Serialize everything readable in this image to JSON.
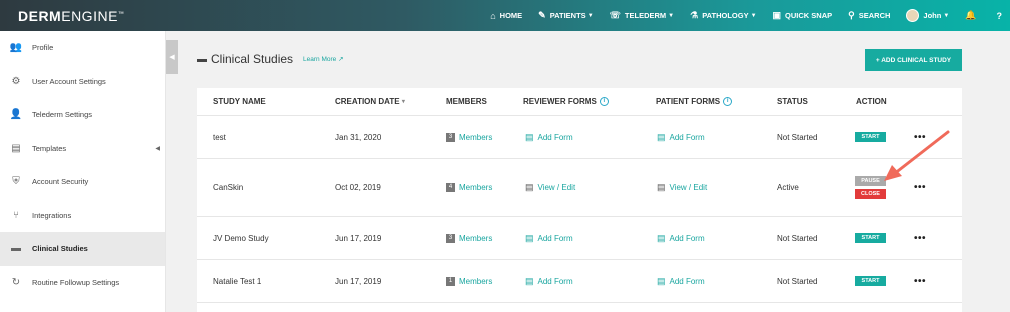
{
  "header": {
    "logo_bold": "DERM",
    "logo_light": "ENGINE",
    "logo_tm": "™",
    "nav": [
      {
        "label": "HOME",
        "icon": "home-icon",
        "caret": false
      },
      {
        "label": "PATIENTS",
        "icon": "patients-icon",
        "caret": true
      },
      {
        "label": "TELEDERM",
        "icon": "telederm-icon",
        "caret": true
      },
      {
        "label": "PATHOLOGY",
        "icon": "pathology-icon",
        "caret": true
      },
      {
        "label": "QUICK SNAP",
        "icon": "camera-icon",
        "caret": false
      },
      {
        "label": "SEARCH",
        "icon": "search-icon",
        "caret": false
      },
      {
        "label": "John",
        "icon": "avatar",
        "caret": true
      }
    ]
  },
  "sidebar": {
    "items": [
      {
        "label": "Profile",
        "icon": "users-icon"
      },
      {
        "label": "User Account Settings",
        "icon": "gear-icon"
      },
      {
        "label": "Telederm Settings",
        "icon": "telederm-settings-icon"
      },
      {
        "label": "Templates",
        "icon": "document-icon"
      },
      {
        "label": "Account Security",
        "icon": "shield-icon"
      },
      {
        "label": "Integrations",
        "icon": "integrations-icon"
      },
      {
        "label": "Clinical Studies",
        "icon": "folder-icon"
      },
      {
        "label": "Routine Followup Settings",
        "icon": "refresh-icon"
      }
    ]
  },
  "main": {
    "title": "Clinical Studies",
    "learn_more": "Learn More",
    "add_button": "+ ADD CLINICAL STUDY",
    "columns": [
      "STUDY NAME",
      "CREATION DATE",
      "MEMBERS",
      "REVIEWER FORMS",
      "PATIENT FORMS",
      "STATUS",
      "ACTION"
    ],
    "sort_indicator": "▾",
    "info_glyph": "i",
    "members_label": "Members",
    "rows": [
      {
        "name": "test",
        "date": "Jan 31, 2020",
        "members": "3",
        "reviewer": "Add Form",
        "patient": "Add Form",
        "status": "Not Started",
        "action": "START"
      },
      {
        "name": "CanSkin",
        "date": "Oct 02, 2019",
        "members": "4",
        "reviewer": "View / Edit",
        "patient": "View / Edit",
        "status": "Active",
        "action_pause": "PAUSE",
        "action_close": "CLOSE"
      },
      {
        "name": "JV Demo Study",
        "date": "Jun 17, 2019",
        "members": "3",
        "reviewer": "Add Form",
        "patient": "Add Form",
        "status": "Not Started",
        "action": "START"
      },
      {
        "name": "Natalie Test 1",
        "date": "Jun 17, 2019",
        "members": "1",
        "reviewer": "Add Form",
        "patient": "Add Form",
        "status": "Not Started",
        "action": "START"
      }
    ],
    "more_glyph": "•••"
  },
  "colors": {
    "accent": "#17aba0",
    "danger": "#e23b3b",
    "pause": "#aaaaaa",
    "arrow": "#f06a5a"
  }
}
